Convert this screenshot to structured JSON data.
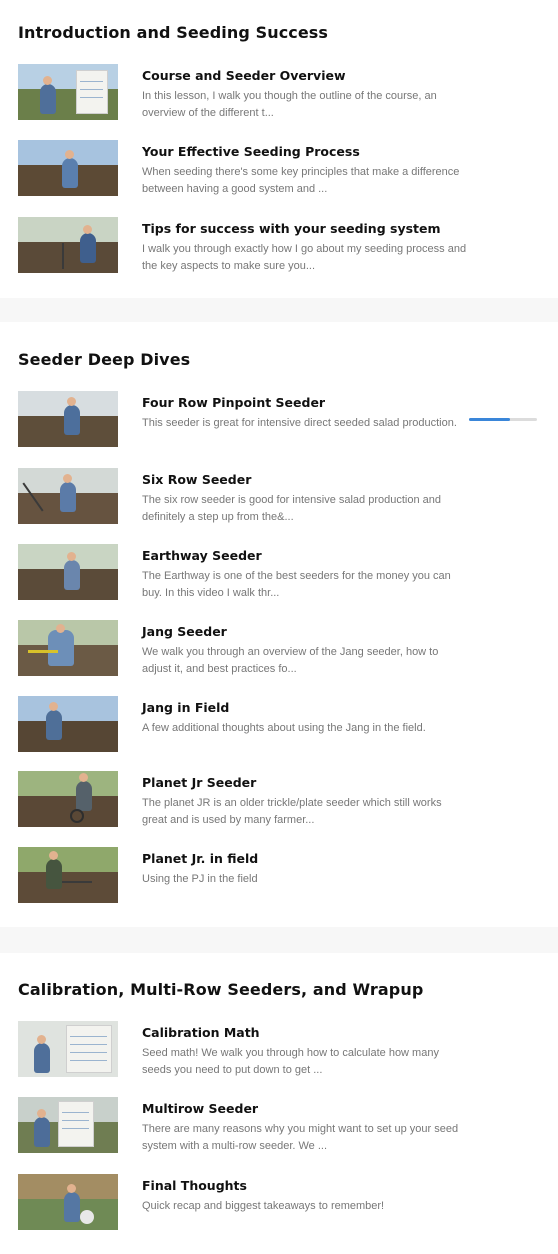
{
  "sections": [
    {
      "title": "Introduction and Seeding Success",
      "lessons": [
        {
          "title": "Course and Seeder Overview",
          "description": " In this lesson, I walk you though the outline of the course, an overview of the different t..."
        },
        {
          "title": "Your Effective Seeding Process",
          "description": "When seeding there's some key principles that make a difference between having a good system and ..."
        },
        {
          "title": "Tips for success with your seeding system",
          "description": "I walk you through exactly how I go about my seeding process and the key aspects to make sure you..."
        }
      ]
    },
    {
      "title": "Seeder Deep Dives",
      "lessons": [
        {
          "title": "Four Row Pinpoint Seeder",
          "description": "This seeder is great for intensive direct seeded salad production.",
          "progress": 0.6
        },
        {
          "title": "Six Row Seeder",
          "description": "The six row seeder is good for intensive salad production and definitely a step up from the&..."
        },
        {
          "title": "Earthway Seeder",
          "description": " The Earthway is one of the best seeders for the money you can buy. In this video I walk thr..."
        },
        {
          "title": "Jang Seeder",
          "description": " We walk you through an overview of the Jang seeder, how to adjust it, and best practices fo..."
        },
        {
          "title": "Jang in Field",
          "description": "A few additional thoughts about using the Jang in the field."
        },
        {
          "title": "Planet Jr Seeder",
          "description": "The planet JR is an older trickle/plate seeder which still works great and is used by many farmer..."
        },
        {
          "title": "Planet Jr. in field",
          "description": "Using the PJ in the field"
        }
      ]
    },
    {
      "title": "Calibration, Multi-Row Seeders, and Wrapup",
      "lessons": [
        {
          "title": "Calibration Math",
          "description": "Seed math!  We walk you through how to calculate how many seeds you need to put down to get ..."
        },
        {
          "title": "Multirow Seeder",
          "description": "There are many reasons why you might want to set up your seed system with a multi-row seeder. We ..."
        },
        {
          "title": "Final Thoughts",
          "description": "Quick recap and biggest takeaways to remember!"
        }
      ]
    }
  ],
  "icons": {
    "progress_fill_color": "#3a86d9",
    "progress_track_color": "#dcdcdc"
  }
}
